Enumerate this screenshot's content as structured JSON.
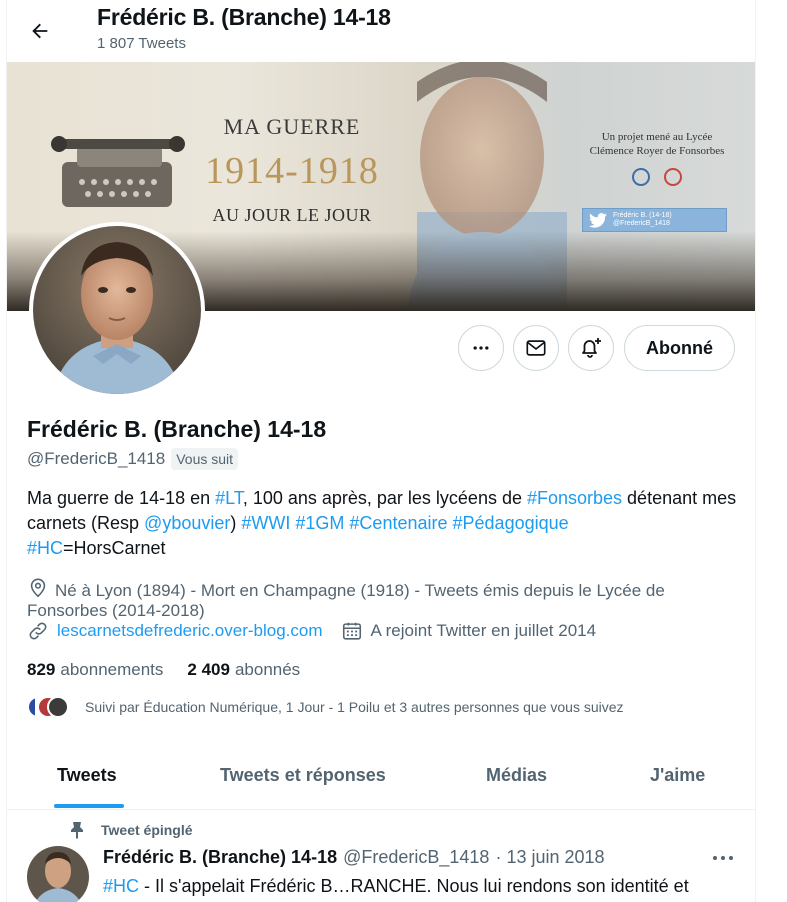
{
  "header": {
    "title": "Frédéric B. (Branche) 14-18",
    "tweet_count": "1 807 Tweets"
  },
  "banner": {
    "line1": "MA GUERRE",
    "line2": "1914-1918",
    "line3": "AU JOUR LE JOUR",
    "project_line1": "Un projet mené au Lycée",
    "project_line2": "Clémence Royer de Fonsorbes",
    "twitter_box": "Frédéric B. (14-18) @FredericB_1418"
  },
  "actions": {
    "follow_label": "Abonné"
  },
  "profile": {
    "name": "Frédéric B. (Branche) 14-18",
    "handle": "@FredericB_1418",
    "follows_you": "Vous suit",
    "bio": {
      "t1": "Ma guerre de 14-18 en ",
      "h1": "#LT",
      "t2": ", 100 ans après, par les lycéens de ",
      "h2": "#Fonsorbes",
      "t3": " détenant mes carnets (Resp ",
      "m1": "@ybouvier",
      "t4": ") ",
      "h3": "#WWI",
      "h4": "#1GM",
      "h5": "#Centenaire",
      "h6": "#Pédagogique",
      "h7": "#HC",
      "t5": "=HorsCarnet"
    },
    "location": "Né à Lyon (1894) - Mort en Champagne (1918) - Tweets émis depuis le Lycée de Fonsorbes (2014-2018)",
    "website": "lescarnetsdefrederic.over-blog.com",
    "joined": "A rejoint Twitter en juillet 2014",
    "following_count": "829",
    "following_label": "abonnements",
    "followers_count": "2 409",
    "followers_label": "abonnés",
    "followed_by": "Suivi par Éducation Numérique, 1 Jour - 1 Poilu et 3 autres personnes que vous suivez"
  },
  "tabs": [
    "Tweets",
    "Tweets et réponses",
    "Médias",
    "J'aime"
  ],
  "pinned_tweet": {
    "pin_label": "Tweet épinglé",
    "name": "Frédéric B. (Branche) 14-18",
    "handle": "@FredericB_1418",
    "date": "· 13 juin 2018",
    "hashtag": "#HC",
    "text": " - Il s'appelait Frédéric B…RANCHE. Nous lui rendons son identité et"
  },
  "colors": {
    "accent": "#1d9bf0",
    "text_primary": "#0f1419",
    "text_secondary": "#536471",
    "border": "#cfd9de"
  },
  "icons": [
    "back-arrow-icon",
    "more-icon",
    "mail-icon",
    "bell-plus-icon",
    "location-icon",
    "link-icon",
    "calendar-icon",
    "pin-icon"
  ]
}
